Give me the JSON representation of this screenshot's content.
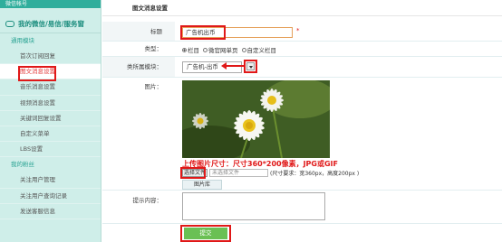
{
  "sidebar": {
    "top_label": "微信帐号",
    "mine_label": "我的微信/易信/服务窗",
    "sections": [
      {
        "title": "通用模块",
        "items": [
          {
            "label": "首次订阅回复",
            "active": false
          },
          {
            "label": "图文消息设置",
            "active": true
          },
          {
            "label": "音乐消息设置",
            "active": false
          },
          {
            "label": "视频消息设置",
            "active": false
          },
          {
            "label": "关键词回复设置",
            "active": false
          },
          {
            "label": "自定义菜单",
            "active": false
          },
          {
            "label": "LBS设置",
            "active": false
          }
        ]
      },
      {
        "title": "我的粉丝",
        "items": [
          {
            "label": "关注用户管理",
            "active": false
          },
          {
            "label": "关注用户查询记录",
            "active": false
          },
          {
            "label": "发送客服信息",
            "active": false
          }
        ]
      }
    ]
  },
  "main": {
    "header": "图文消息设置",
    "form": {
      "title_label": "标题",
      "title_value": "广告机出币",
      "required_mark": "*",
      "type_label": "类型：",
      "type_options": [
        "栏目",
        "微官网单页",
        "自定义栏目"
      ],
      "type_selected": "栏目",
      "module_label": "类所属模块：",
      "module_value": "广告机-出币",
      "image_label": "图片：",
      "upload_tip": "上传图片尺寸：尺寸360*200像素，JPG或GIF",
      "choose_file_label": "选择文件",
      "file_name_placeholder": "未选择文件",
      "size_hint": "(尺寸要求：宽360px，高度200px )",
      "image_lib_label": "图片库",
      "prompt_label": "提示内容：",
      "prompt_value": "",
      "submit_label": "提交"
    }
  },
  "colors": {
    "sidebar_bg": "#cfeee9",
    "accent": "#2aa393",
    "highlight": "#e01818",
    "submit_bg": "#6ac054"
  }
}
